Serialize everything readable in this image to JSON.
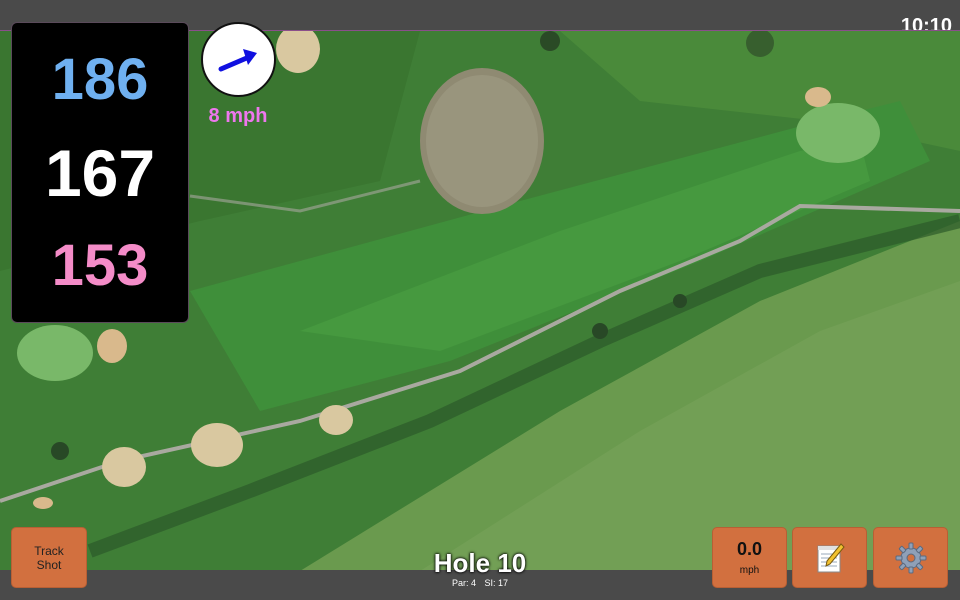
{
  "status_bar": {
    "time": "10:10"
  },
  "distances": {
    "back": "186",
    "center": "167",
    "front": "153"
  },
  "wind": {
    "speed_label": "8 mph",
    "arrow_color": "#1010e0",
    "direction": "north-east"
  },
  "buttons": {
    "track_shot_line1": "Track",
    "track_shot_line2": "Shot",
    "speed_value": "0.0",
    "speed_unit": "mph",
    "notes_icon": "notepad-icon",
    "settings_icon": "gear-icon"
  },
  "hole": {
    "title": "Hole 10",
    "par": "Par: 4",
    "si": "SI: 17"
  },
  "colors": {
    "button_orange": "#d2703f",
    "back_distance": "#6fb0f0",
    "center_distance": "#ffffff",
    "front_distance": "#f48cc8",
    "wind_text": "#ee77ee"
  }
}
